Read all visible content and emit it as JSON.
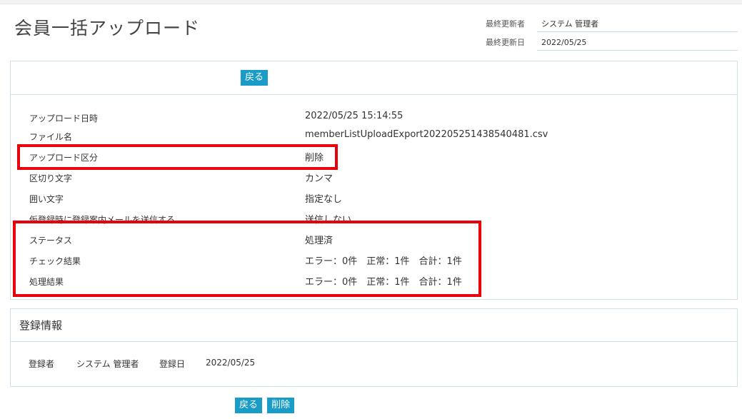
{
  "page": {
    "title": "会員一括アップロード"
  },
  "meta": {
    "updater_label": "最終更新者",
    "updater_value": "システム 管理者",
    "updated_label": "最終更新日",
    "updated_value": "2022/05/25"
  },
  "buttons": {
    "back": "戻る",
    "delete": "削除"
  },
  "details": [
    {
      "label": "アップロード日時",
      "value": "2022/05/25 15:14:55"
    },
    {
      "label": "ファイル名",
      "value": "memberListUploadExport202205251438540481.csv"
    },
    {
      "label": "アップロード区分",
      "value": "削除"
    },
    {
      "label": "区切り文字",
      "value": "カンマ"
    },
    {
      "label": "囲い文字",
      "value": "指定なし"
    },
    {
      "label": "仮登録時に登録案内メールを送信する",
      "value": "送信しない"
    },
    {
      "label": "ステータス",
      "value": "処理済"
    },
    {
      "label": "チェック結果",
      "value": "エラー：0件　正常：1件　合計：1件"
    },
    {
      "label": "処理結果",
      "value": "エラー：0件　正常：1件　合計：1件"
    }
  ],
  "registration": {
    "title": "登録情報",
    "registrant_label": "登録者",
    "registrant_value": "システム 管理者",
    "date_label": "登録日",
    "date_value": "2022/05/25"
  },
  "colors": {
    "button": "#1a9cc8",
    "highlight": "#e8000b",
    "border": "#cfe0e8"
  }
}
